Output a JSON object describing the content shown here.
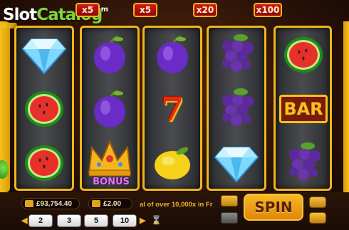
{
  "logo": {
    "slot": "Slot",
    "catalog": "Catalog",
    "com": ".com"
  },
  "multipliers": [
    "x5",
    "x5",
    "x20",
    "x100"
  ],
  "reels": [
    [
      "diamond",
      "watermelon",
      "watermelon"
    ],
    [
      "plum",
      "plum",
      "bonus-crown"
    ],
    [
      "plum",
      "seven",
      "lemon"
    ],
    [
      "grapes",
      "grapes",
      "diamond"
    ],
    [
      "watermelon",
      "bar",
      "grapes"
    ]
  ],
  "symbols": {
    "bar_text": "BAR",
    "seven_text": "7",
    "bonus_text": "BONUS"
  },
  "balance": "£93,754.40",
  "bet": "£2.00",
  "ticker": "al of over 10,000x in Fr",
  "spin_label": "SPIN",
  "bet_options": [
    "2",
    "3",
    "5",
    "10"
  ],
  "colors": {
    "reel_frame": "#f1b51a",
    "spin": "#f7b923",
    "brand_green": "#7cd33a"
  }
}
